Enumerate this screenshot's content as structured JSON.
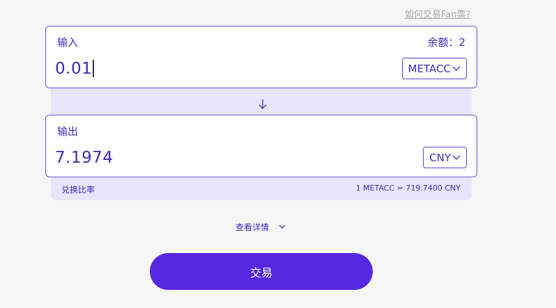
{
  "help_link": "如何交易Fan票?",
  "input_panel": {
    "label": "输入",
    "balance": "余额：2",
    "amount": "0.01",
    "token": "METACC",
    "token_icon": "chevron-down-icon"
  },
  "swap_direction_icon": "arrow-down-icon",
  "output_panel": {
    "label": "输出",
    "amount": "7.1974",
    "token": "CNY",
    "token_icon": "chevron-down-icon"
  },
  "rate": {
    "label": "兑换比率",
    "value": "1 METACC = 719.7400 CNY"
  },
  "details_toggle": "查看详情",
  "trade_button": "交易",
  "colors": {
    "accent": "#5429e0",
    "text": "#3f2ab8",
    "band": "#e8e4fb",
    "background": "#f6f6f6"
  }
}
